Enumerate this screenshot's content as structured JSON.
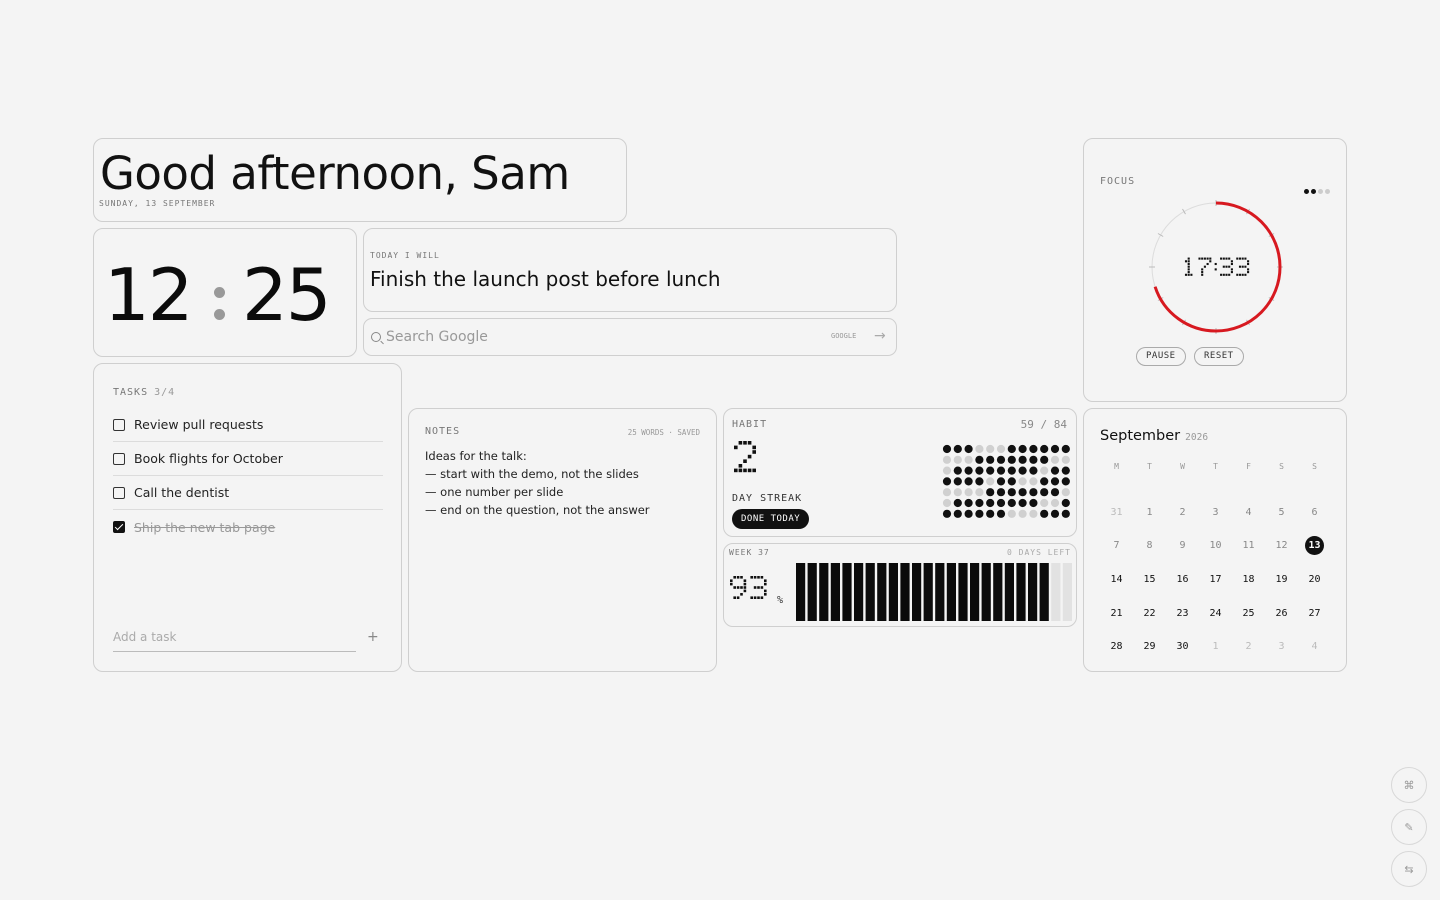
{
  "greeting": {
    "title": "Good afternoon, Sam",
    "date": "SUNDAY, 13 SEPTEMBER"
  },
  "clock": {
    "hours": "12",
    "minutes": "25"
  },
  "intent": {
    "label": "TODAY I WILL",
    "text": "Finish the launch post before lunch"
  },
  "search": {
    "placeholder": "Search Google",
    "engine": "GOOGLE"
  },
  "tasks": {
    "label": "TASKS",
    "count": "3/4",
    "items": [
      {
        "text": "Review pull requests",
        "done": false
      },
      {
        "text": "Book flights for October",
        "done": false
      },
      {
        "text": "Call the dentist",
        "done": false
      },
      {
        "text": "Ship the new tab page",
        "done": true
      }
    ],
    "add_placeholder": "Add a task"
  },
  "notes": {
    "label": "NOTES",
    "meta": "25 WORDS · SAVED",
    "lines": [
      "Ideas for the talk:",
      "— start with the demo, not the slides",
      "— one number per slide",
      "— end on the question, not the answer"
    ]
  },
  "habit": {
    "label": "HABIT",
    "count": "59 / 84",
    "streak_value": 2,
    "streak_label": "DAY STREAK",
    "done_label": "DONE TODAY",
    "grid": [
      "111000111111",
      "000111111100",
      "011111111011",
      "111101100111",
      "000011111110",
      "011111111001",
      "111111000111"
    ]
  },
  "week": {
    "label": "WEEK 37",
    "days_left": "0 DAYS LEFT",
    "percent": 93,
    "percent_sign": "%",
    "bars_total": 24,
    "bars_filled": 22
  },
  "focus": {
    "label": "FOCUS",
    "time": "17:33",
    "progress": 0.7,
    "pause_label": "PAUSE",
    "reset_label": "RESET",
    "sessions_total": 4,
    "sessions_done": 2
  },
  "calendar": {
    "month": "September",
    "year": "2026",
    "weekdays": [
      "M",
      "T",
      "W",
      "T",
      "F",
      "S",
      "S"
    ],
    "days": [
      [
        "31",
        0
      ],
      [
        "1",
        1
      ],
      [
        "2",
        1
      ],
      [
        "3",
        1
      ],
      [
        "4",
        1
      ],
      [
        "5",
        1
      ],
      [
        "6",
        1
      ],
      [
        "7",
        1
      ],
      [
        "8",
        1
      ],
      [
        "9",
        1
      ],
      [
        "10",
        1
      ],
      [
        "11",
        1
      ],
      [
        "12",
        1
      ],
      [
        "13",
        2
      ],
      [
        "14",
        3
      ],
      [
        "15",
        3
      ],
      [
        "16",
        3
      ],
      [
        "17",
        3
      ],
      [
        "18",
        3
      ],
      [
        "19",
        3
      ],
      [
        "20",
        3
      ],
      [
        "21",
        3
      ],
      [
        "22",
        3
      ],
      [
        "23",
        3
      ],
      [
        "24",
        3
      ],
      [
        "25",
        3
      ],
      [
        "26",
        3
      ],
      [
        "27",
        3
      ],
      [
        "28",
        3
      ],
      [
        "29",
        3
      ],
      [
        "30",
        3
      ],
      [
        "1",
        0
      ],
      [
        "2",
        0
      ],
      [
        "3",
        0
      ],
      [
        "4",
        0
      ]
    ]
  },
  "side_buttons": [
    {
      "icon": "command-icon",
      "glyph": "⌘"
    },
    {
      "icon": "pencil-icon",
      "glyph": "✎"
    },
    {
      "icon": "swap-icon",
      "glyph": "⇆"
    }
  ],
  "colors": {
    "background": "#f4f4f4",
    "accent": "#d71920",
    "ink": "#111111"
  }
}
